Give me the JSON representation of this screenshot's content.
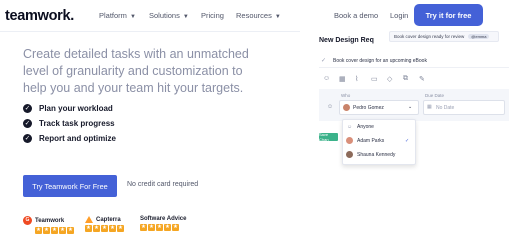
{
  "nav": {
    "logo": "teamwork.",
    "links": [
      "Platform",
      "Solutions",
      "Pricing",
      "Resources"
    ],
    "book_demo": "Book a demo",
    "login": "Login",
    "cta": "Try it for free"
  },
  "hero": {
    "headline": "Create detailed tasks with an unmatched level of granularity and customization to help you and your team hit your targets.",
    "features": [
      "Plan your workload",
      "Track task progress",
      "Report and optimize"
    ],
    "primary_button": "Try Teamwork For Free",
    "note": "No credit card required"
  },
  "ratings": [
    {
      "name": "Teamwork",
      "stars": 5
    },
    {
      "name": "Capterra",
      "stars": 5
    },
    {
      "name": "Software Advice",
      "stars": 5
    }
  ],
  "mockup": {
    "title": "New Design Req",
    "tooltip": "Book cover design ready for review",
    "tooltip_tag": "@emma",
    "task": "Book cover design for an upcoming eBook",
    "who_label": "Who",
    "who_value": "Pedro Gomez",
    "due_label": "Due Date",
    "due_placeholder": "No Date",
    "save_label": "Save Chan",
    "options": [
      "Anyone",
      "Adam Parks",
      "Shauna Kennedy"
    ]
  },
  "colors": {
    "accent": "#4461d7",
    "star": "#f5a623",
    "save": "#3bb28a"
  }
}
